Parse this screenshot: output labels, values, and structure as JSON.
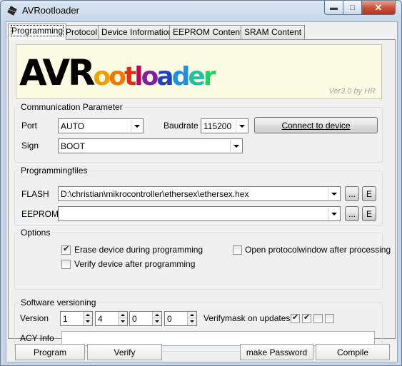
{
  "window": {
    "title": "AVRootloader",
    "minimize_icon": "minimize-icon",
    "maximize_icon": "maximize-icon",
    "close_icon": "close-icon"
  },
  "tabs": [
    {
      "label": "Programming",
      "active": true
    },
    {
      "label": "Protocol",
      "active": false
    },
    {
      "label": "Device Information",
      "active": false
    },
    {
      "label": "EEPROM Content",
      "active": false
    },
    {
      "label": "SRAM Content",
      "active": false
    }
  ],
  "logo": {
    "text": "AVRootloader",
    "letters": [
      "A",
      "V",
      "R",
      "o",
      "o",
      "t",
      "l",
      "o",
      "a",
      "d",
      "e",
      "r"
    ],
    "letter_colors": [
      "#000000",
      "#000000",
      "#000000",
      "#f0a000",
      "#f07800",
      "#e03010",
      "#c00060",
      "#8020a0",
      "#2040c0",
      "#2090e0",
      "#20c0a0",
      "#20d060"
    ],
    "version": "Ver3.0 by HR"
  },
  "communication": {
    "title": "Communication Parameter",
    "port_label": "Port",
    "port_value": "AUTO",
    "baudrate_label": "Baudrate",
    "baudrate_value": "115200",
    "connect_label": "Connect to device",
    "sign_label": "Sign",
    "sign_value": "BOOT"
  },
  "programmingfiles": {
    "title": "Programmingfiles",
    "flash_label": "FLASH",
    "flash_value": "D:\\christian\\mikrocontroller\\ethersex\\ethersex.hex",
    "eeprom_label": "EEPROM",
    "eeprom_value": "",
    "browse_label": "...",
    "edit_label": "E"
  },
  "options": {
    "title": "Options",
    "erase_label": "Erase device during programming",
    "erase_checked": true,
    "verify_label": "Verify device after programming",
    "verify_checked": false,
    "protocol_label": "Open protocolwindow after processing",
    "protocol_checked": false
  },
  "versioning": {
    "title": "Software versioning",
    "version_label": "Version",
    "version_values": [
      "1",
      "4",
      "0",
      "0"
    ],
    "verifymask_label": "Verifymask on updates",
    "verifymask_checks": [
      true,
      true,
      false,
      false
    ],
    "acy_label": "ACY Info",
    "acy_value": ""
  },
  "actions": {
    "program_label": "Program",
    "verify_label": "Verify",
    "password_label": "make Password",
    "compile_label": "Compile"
  }
}
